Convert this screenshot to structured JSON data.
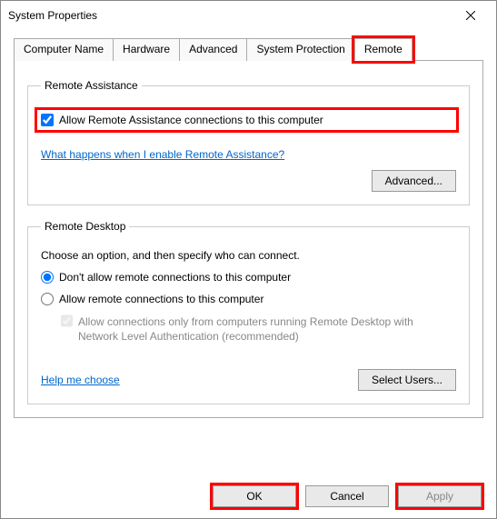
{
  "window": {
    "title": "System Properties"
  },
  "tabs": {
    "items": [
      {
        "label": "Computer Name"
      },
      {
        "label": "Hardware"
      },
      {
        "label": "Advanced"
      },
      {
        "label": "System Protection"
      },
      {
        "label": "Remote"
      }
    ],
    "active_index": 4
  },
  "remote_assistance": {
    "legend": "Remote Assistance",
    "allow_label": "Allow Remote Assistance connections to this computer",
    "allow_checked": true,
    "help_link": "What happens when I enable Remote Assistance?",
    "advanced_btn": "Advanced..."
  },
  "remote_desktop": {
    "legend": "Remote Desktop",
    "instruction": "Choose an option, and then specify who can connect.",
    "option_deny": "Don't allow remote connections to this computer",
    "option_allow": "Allow remote connections to this computer",
    "selected": "deny",
    "nla_label": "Allow connections only from computers running Remote Desktop with Network Level Authentication (recommended)",
    "nla_checked": true,
    "nla_disabled": true,
    "help_link": "Help me choose",
    "select_users_btn": "Select Users..."
  },
  "buttons": {
    "ok": "OK",
    "cancel": "Cancel",
    "apply": "Apply",
    "apply_disabled": true
  }
}
